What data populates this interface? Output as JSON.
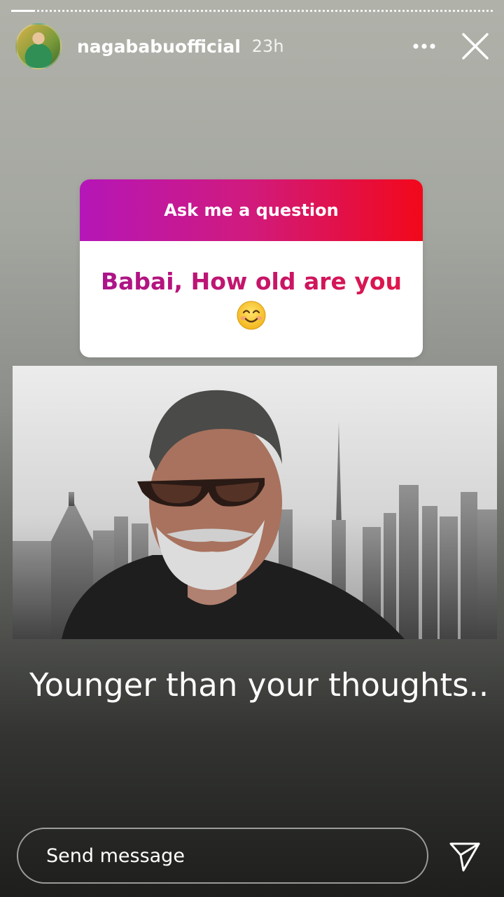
{
  "story": {
    "progress": 0.05
  },
  "header": {
    "username": "nagababuofficial",
    "time": "23h",
    "avatar_icon": "profile-avatar",
    "more_icon": "more-horizontal-icon",
    "close_icon": "close-icon"
  },
  "sticker": {
    "title": "Ask me a question",
    "question": "Babai, How old are you",
    "emoji": "😊",
    "gradient_start": "#b516b8",
    "gradient_end": "#f2081a"
  },
  "photo": {
    "icon": "photo-image"
  },
  "caption": "Younger than your thoughts..",
  "footer": {
    "message_placeholder": "Send message",
    "send_icon": "send-icon"
  }
}
